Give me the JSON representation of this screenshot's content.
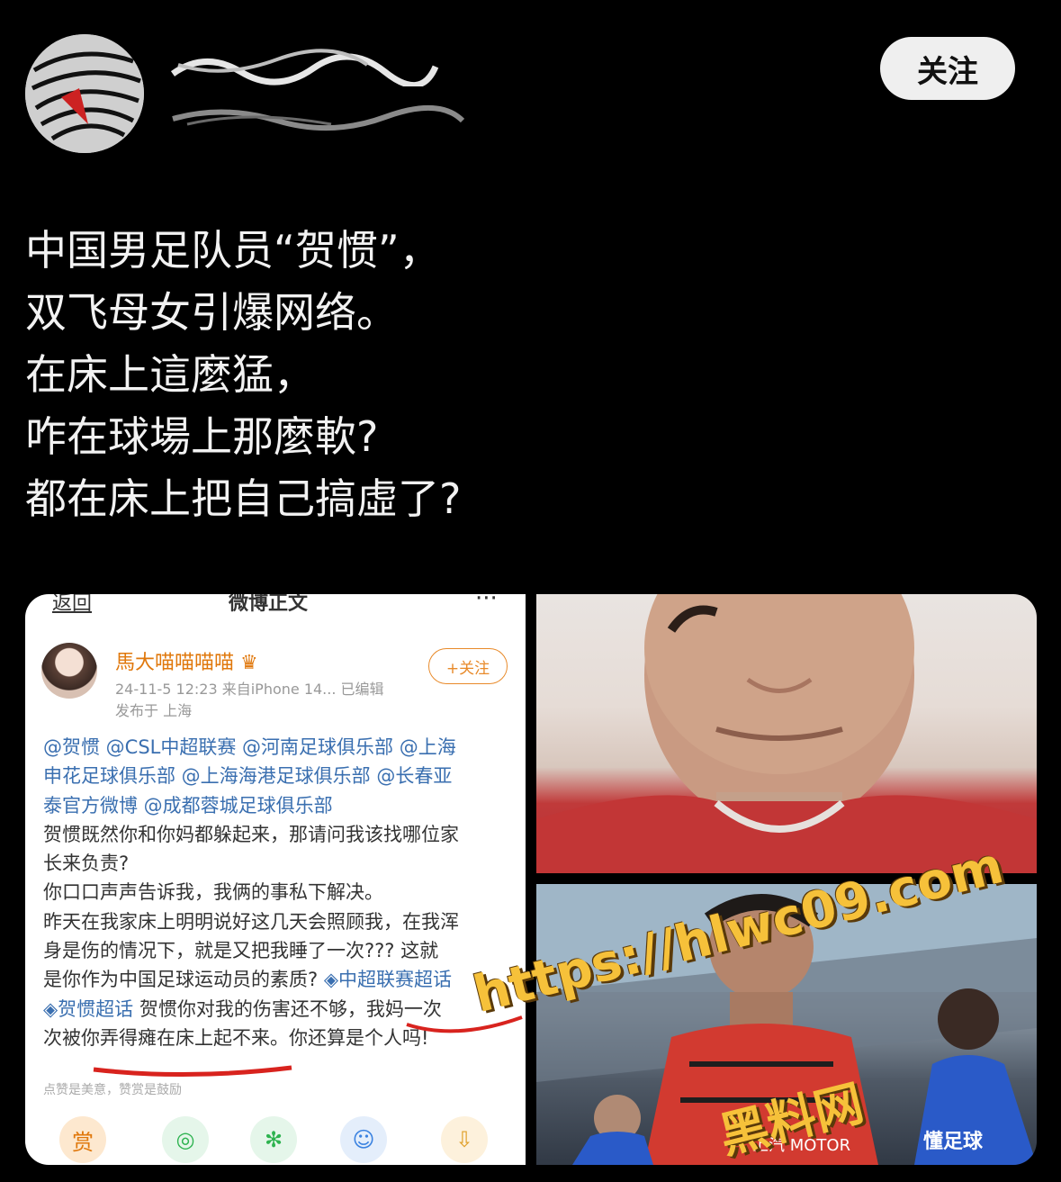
{
  "header": {
    "follow_label": "关注"
  },
  "post": {
    "lines": [
      "中国男足队员“贺惯”，",
      "双飞母女引爆网络。",
      "在床上這麼猛，",
      "咋在球場上那麼軟?",
      "都在床上把自己搞虛了?"
    ]
  },
  "screenshot": {
    "nav_back": "返回",
    "nav_title": "微博正文",
    "nav_more": "···",
    "username": "馬大喵喵喵喵",
    "meta": "24-11-5 12:23  来自iPhone 14...  已编辑",
    "location": "发布于 上海",
    "follow_label": "+关注",
    "lines": [
      "@贺惯 @CSL中超联赛 @河南足球俱乐部 @上海",
      "申花足球俱乐部 @上海海港足球俱乐部 @长春亚",
      "泰官方微博 @成都蓉城足球俱乐部",
      "贺惯既然你和你妈都躲起来，那请问我该找哪位家",
      "长来负责?",
      "你口口声声告诉我，我俩的事私下解决。",
      "昨天在我家床上明明说好这几天会照顾我，在我浑",
      "身是伤的情况下，就是又把我睡了一次??? 这就",
      "是你作为中国足球运动员的素质? ",
      "贺惯超话 ",
      "次被你弄得瘫在床上起不来。你还算是个人吗!"
    ],
    "topic_1": "◈中超联赛超话",
    "topic_2_prefix": "◈",
    "line10_rest": "贺惯你对我的伤害还不够，我妈一次",
    "hint": "点赞是美意，赞赏是鼓励",
    "action_reward": "赏"
  },
  "watermark": {
    "url": "https://hlwc09.com",
    "name": "黑料网"
  },
  "photo_bottom_logo": "懂足球",
  "jersey_text": "上汽 MOTOR"
}
